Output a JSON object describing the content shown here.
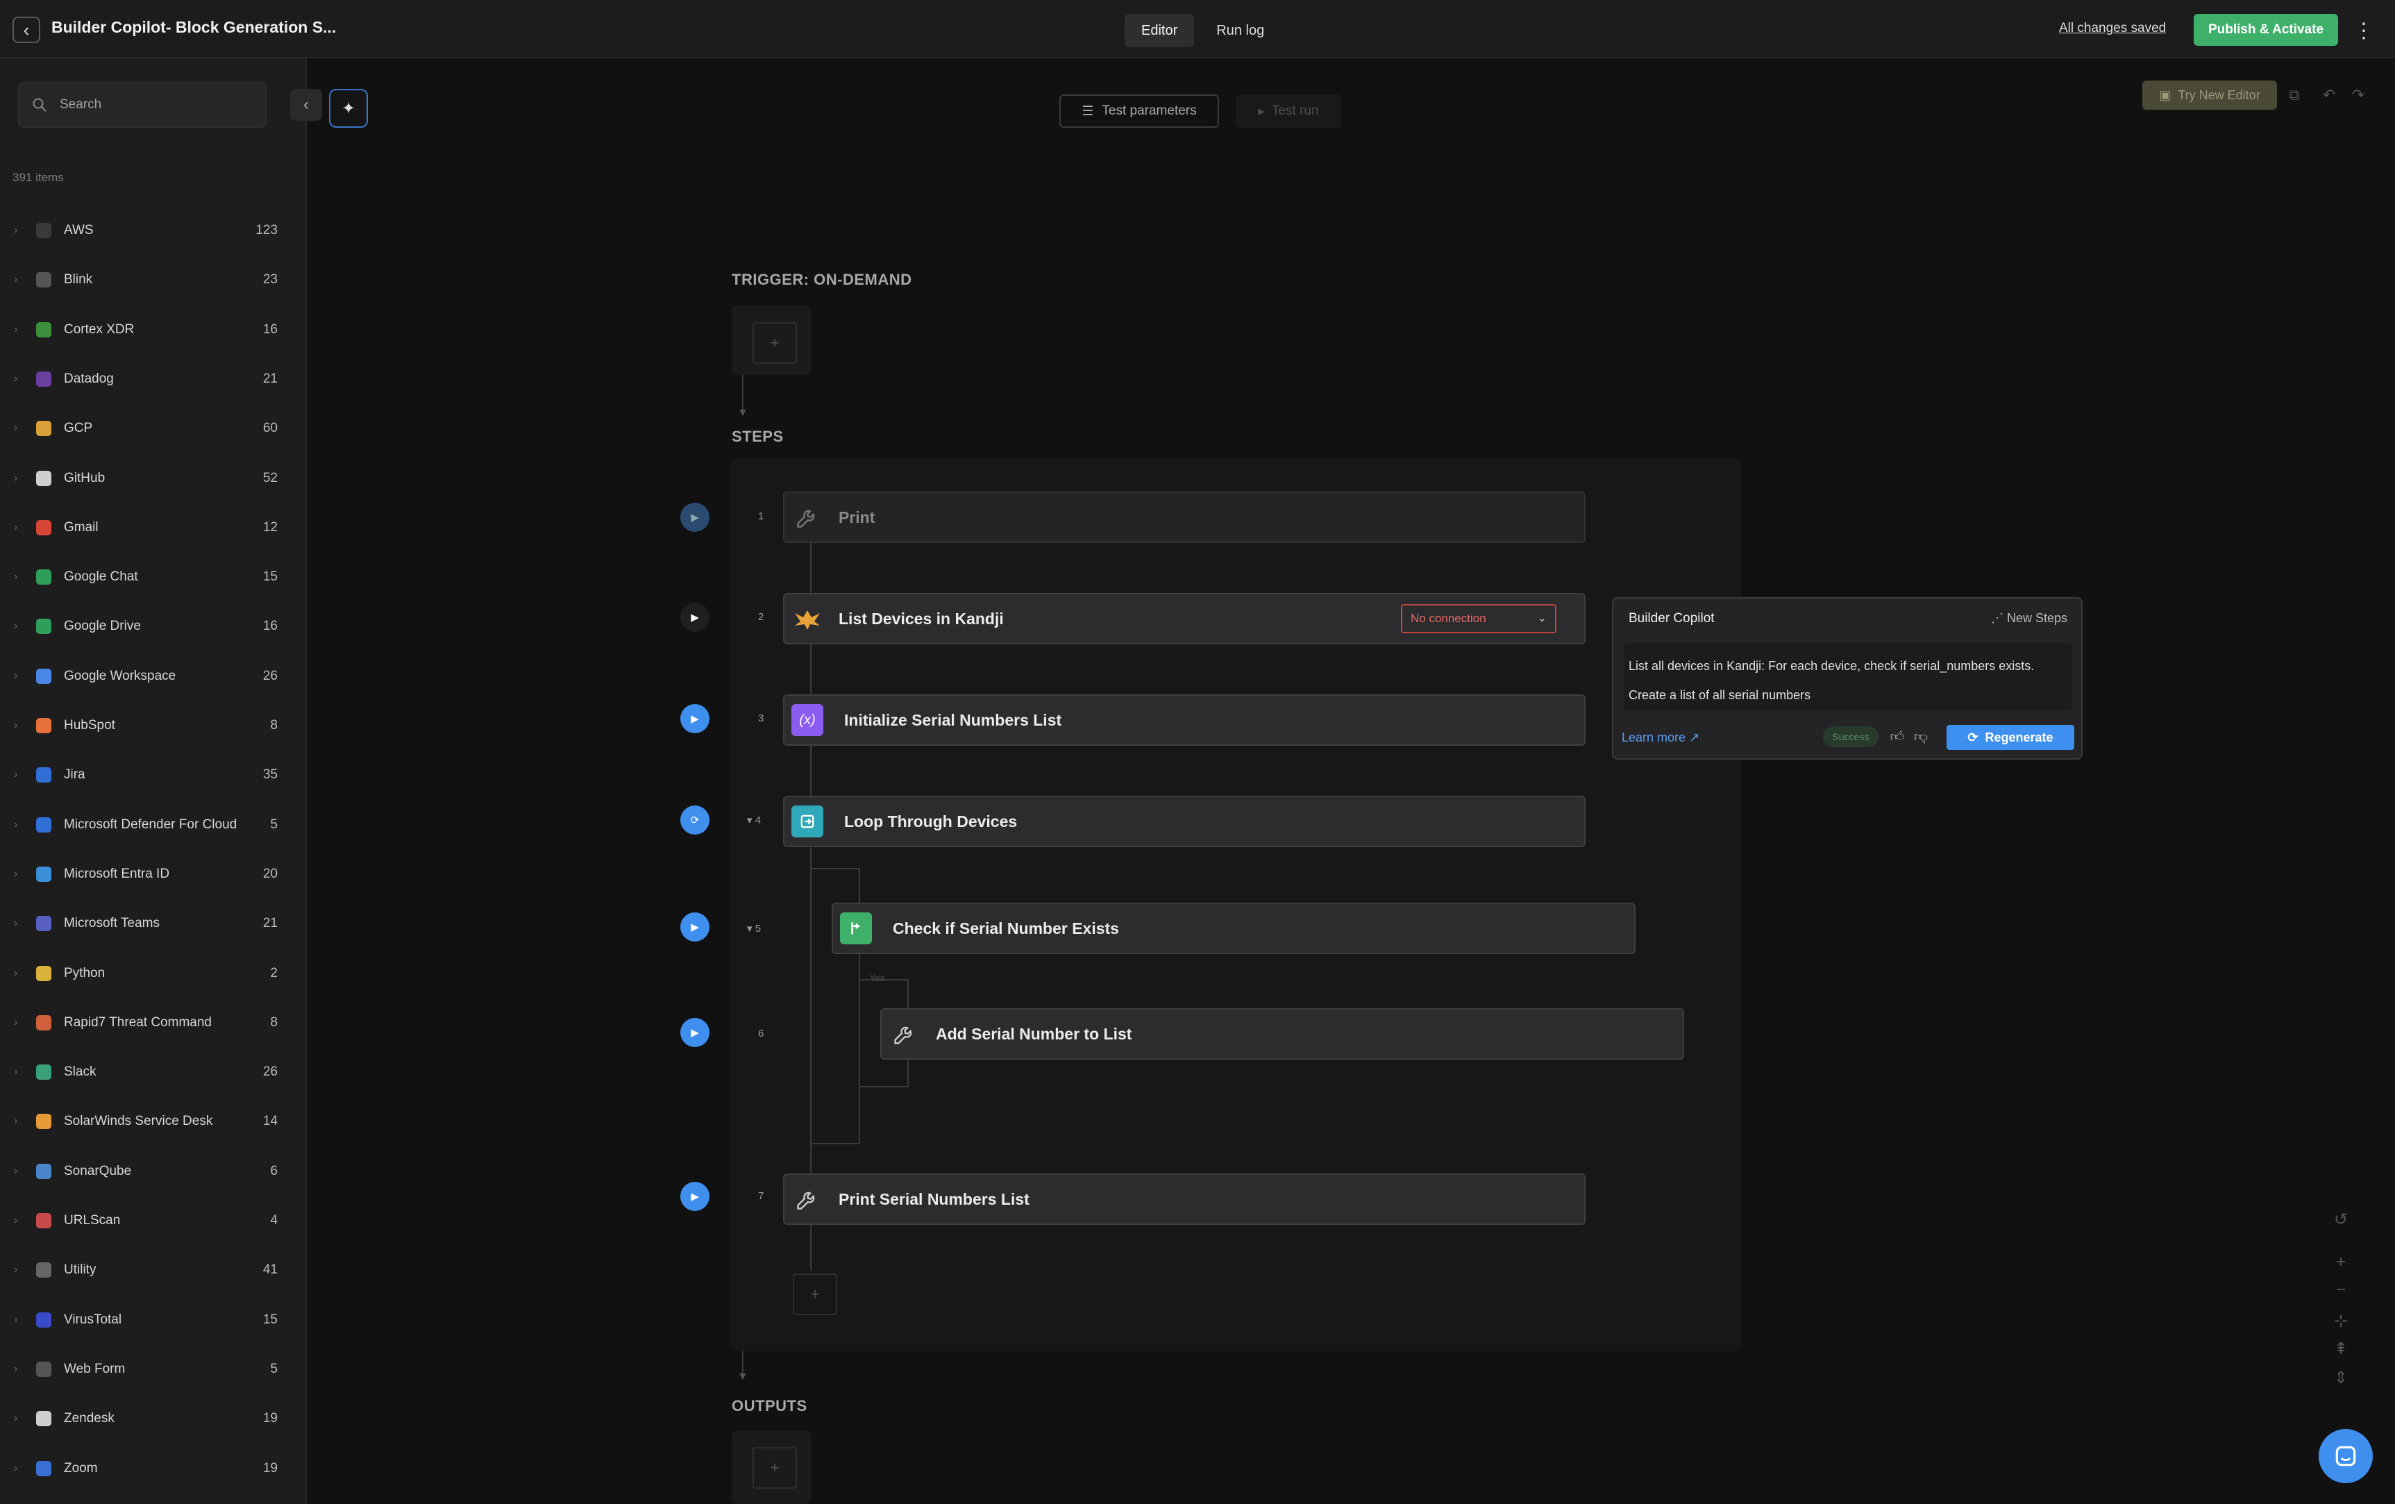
{
  "header": {
    "back_icon": "‹",
    "title": "Builder Copilot- Block Generation S...",
    "tabs": [
      {
        "label": "Editor"
      },
      {
        "label": "Run log"
      }
    ],
    "saved_status": "All changes saved",
    "publish_label": "Publish & Activate",
    "more_icon": "⋮"
  },
  "sidebar": {
    "search_placeholder": "Search",
    "item_count": "391 items",
    "items": [
      {
        "label": "AWS",
        "count": "123",
        "color": "#3a3a3a"
      },
      {
        "label": "Blink",
        "count": "23",
        "color": "#555555"
      },
      {
        "label": "Cortex XDR",
        "count": "16",
        "color": "#3d8f3d"
      },
      {
        "label": "Datadog",
        "count": "21",
        "color": "#6b3fa0"
      },
      {
        "label": "GCP",
        "count": "60",
        "color": "#d9a13a"
      },
      {
        "label": "GitHub",
        "count": "52",
        "color": "#cfcfcf"
      },
      {
        "label": "Gmail",
        "count": "12",
        "color": "#d64535"
      },
      {
        "label": "Google Chat",
        "count": "15",
        "color": "#2f9e5a"
      },
      {
        "label": "Google Drive",
        "count": "16",
        "color": "#2f9e5a"
      },
      {
        "label": "Google Workspace",
        "count": "26",
        "color": "#4a86e8"
      },
      {
        "label": "HubSpot",
        "count": "8",
        "color": "#e8703a"
      },
      {
        "label": "Jira",
        "count": "35",
        "color": "#2f6fd6"
      },
      {
        "label": "Microsoft Defender For Cloud",
        "count": "5",
        "color": "#2f6fd6"
      },
      {
        "label": "Microsoft Entra ID",
        "count": "20",
        "color": "#3a8fd6"
      },
      {
        "label": "Microsoft Teams",
        "count": "21",
        "color": "#5a5fc4"
      },
      {
        "label": "Python",
        "count": "2",
        "color": "#d9b13a"
      },
      {
        "label": "Rapid7 Threat Command",
        "count": "8",
        "color": "#d0603a"
      },
      {
        "label": "Slack",
        "count": "26",
        "color": "#3aa07a"
      },
      {
        "label": "SolarWinds Service Desk",
        "count": "14",
        "color": "#e89a3a"
      },
      {
        "label": "SonarQube",
        "count": "6",
        "color": "#4a86c8"
      },
      {
        "label": "URLScan",
        "count": "4",
        "color": "#c84a4a"
      },
      {
        "label": "Utility",
        "count": "41",
        "color": "#666666"
      },
      {
        "label": "VirusTotal",
        "count": "15",
        "color": "#3a4ac8"
      },
      {
        "label": "Web Form",
        "count": "5",
        "color": "#555555"
      },
      {
        "label": "Zendesk",
        "count": "19",
        "color": "#cfcfcf"
      },
      {
        "label": "Zoom",
        "count": "19",
        "color": "#3a6fd6"
      }
    ]
  },
  "toolbar": {
    "test_params_label": "Test parameters",
    "test_run_label": "Test run",
    "try_new_label": "Try New Editor"
  },
  "flow": {
    "trigger_label": "TRIGGER: ON-DEMAND",
    "steps_label": "STEPS",
    "outputs_label": "OUTPUTS",
    "add_icon": "+",
    "steps": [
      {
        "num": "1",
        "name": "Print",
        "icon": "wrench"
      },
      {
        "num": "2",
        "name": "List Devices in Kandji",
        "icon": "kandji",
        "connection": "No connection"
      },
      {
        "num": "3",
        "name": "Initialize Serial Numbers List",
        "icon": "variable",
        "icon_text": "(x)"
      },
      {
        "num": "▾ 4",
        "name": "Loop Through Devices",
        "icon": "loop"
      },
      {
        "num": "▾ 5",
        "name": "Check if Serial Number Exists",
        "icon": "branch",
        "branch_label": "Yes"
      },
      {
        "num": "6",
        "name": "Add Serial Number to List",
        "icon": "wrench"
      },
      {
        "num": "7",
        "name": "Print Serial Numbers List",
        "icon": "wrench"
      }
    ]
  },
  "copilot": {
    "title": "Builder Copilot",
    "new_steps_label": "New Steps",
    "prompt_line1": "List all devices in Kandji: For each device, check if serial_numbers exists.",
    "prompt_line2": "Create a list of all serial numbers",
    "learn_more_label": "Learn more",
    "status_badge": "Success",
    "regenerate_label": "Regenerate"
  },
  "colors": {
    "accent_blue": "#3f8fef",
    "publish_green": "#3fb06a",
    "error_red": "#c24545"
  }
}
